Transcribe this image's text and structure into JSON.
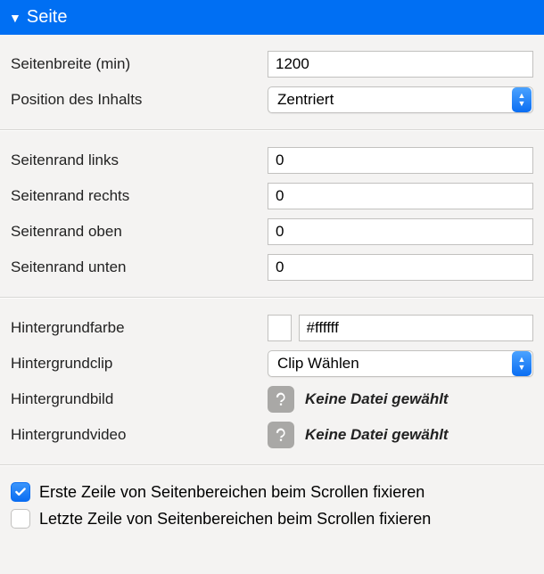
{
  "header": {
    "title": "Seite"
  },
  "rows": {
    "width_min": {
      "label": "Seitenbreite (min)",
      "value": "1200"
    },
    "content_pos": {
      "label": "Position des Inhalts",
      "value": "Zentriert"
    },
    "margin_left": {
      "label": "Seitenrand links",
      "value": "0"
    },
    "margin_right": {
      "label": "Seitenrand rechts",
      "value": "0"
    },
    "margin_top": {
      "label": "Seitenrand oben",
      "value": "0"
    },
    "margin_bottom": {
      "label": "Seitenrand unten",
      "value": "0"
    },
    "bg_color": {
      "label": "Hintergrundfarbe",
      "value": "#ffffff"
    },
    "bg_clip": {
      "label": "Hintergrundclip",
      "value": "Clip Wählen"
    },
    "bg_image": {
      "label": "Hintergrundbild",
      "status": "Keine Datei gewählt"
    },
    "bg_video": {
      "label": "Hintergrundvideo",
      "status": "Keine Datei gewählt"
    }
  },
  "checks": {
    "fix_first": {
      "label": "Erste Zeile von Seitenbereichen beim Scrollen fixieren",
      "checked": true
    },
    "fix_last": {
      "label": "Letzte Zeile von Seitenbereichen beim Scrollen fixieren",
      "checked": false
    }
  }
}
